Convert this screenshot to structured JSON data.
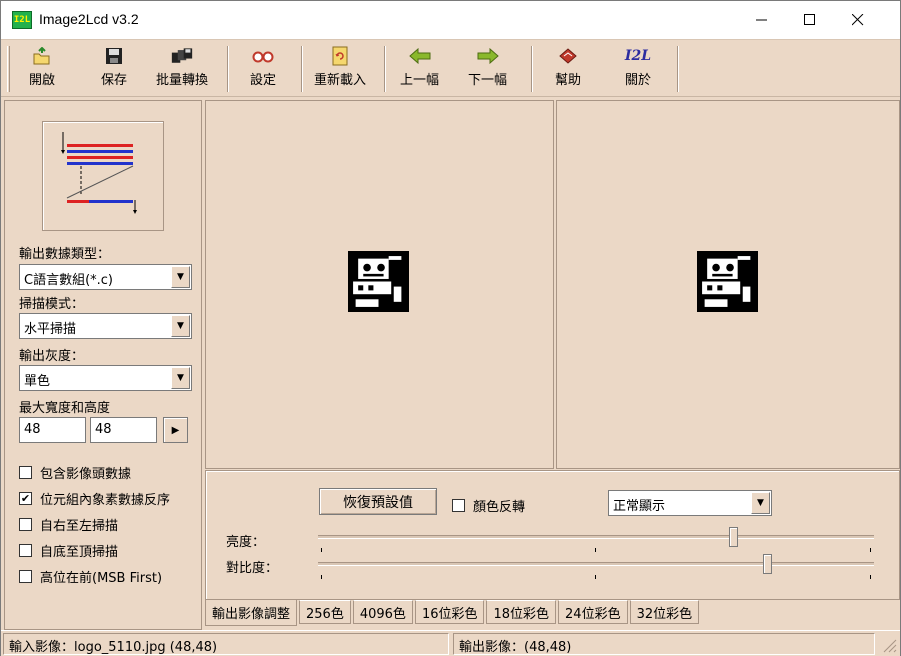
{
  "window": {
    "title": "Image2Lcd v3.2",
    "icon_text": "I2L",
    "controls": {
      "minimize": "—",
      "maximize": "☐",
      "close": "✕"
    }
  },
  "toolbar": {
    "items": [
      {
        "label": "開啟",
        "icon": "open-folder-icon"
      },
      {
        "label": "保存",
        "icon": "floppy-disk-icon"
      },
      {
        "label": "批量轉換",
        "icon": "batch-convert-icon"
      },
      {
        "label": "設定",
        "icon": "glasses-settings-icon"
      },
      {
        "label": "重新載入",
        "icon": "reload-document-icon"
      },
      {
        "label": "上一幅",
        "icon": "arrow-left-icon"
      },
      {
        "label": "下一幅",
        "icon": "arrow-right-icon"
      },
      {
        "label": "幫助",
        "icon": "help-book-icon"
      },
      {
        "label": "關於",
        "icon": "i2l-logo-icon",
        "icon_text": "I2L"
      }
    ]
  },
  "settings": {
    "output_type_label": "輸出數據類型：",
    "output_type_value": "C語言數組(*.c)",
    "scan_mode_label": "掃描模式：",
    "scan_mode_value": "水平掃描",
    "gray_label": "輸出灰度：",
    "gray_value": "單色",
    "max_size_label": "最大寬度和高度",
    "max_width": "48",
    "max_height": "48",
    "checkboxes": [
      {
        "label": "包含影像頭數據",
        "checked": false
      },
      {
        "label": "位元組內象素數據反序",
        "checked": true
      },
      {
        "label": "自右至左掃描",
        "checked": false
      },
      {
        "label": "自底至頂掃描",
        "checked": false
      },
      {
        "label": "高位在前(MSB First)",
        "checked": false
      }
    ]
  },
  "adjust": {
    "reset_label": "恢復預設值",
    "invert_label": "顏色反轉",
    "invert_checked": false,
    "display_mode_value": "正常顯示",
    "brightness_label": "亮度：",
    "brightness_fraction": 0.74,
    "contrast_label": "對比度：",
    "contrast_fraction": 0.8
  },
  "tabs": [
    "輸出影像調整",
    "256色",
    "4096色",
    "16位彩色",
    "18位彩色",
    "24位彩色",
    "32位彩色"
  ],
  "active_tab": 0,
  "status": {
    "input": "輸入影像：logo_5110.jpg (48,48)",
    "output": "輸出影像：(48,48)"
  },
  "colors": {
    "background": "#ebd8c6",
    "border": "#a89585",
    "icon_bg": "#22b14c"
  }
}
